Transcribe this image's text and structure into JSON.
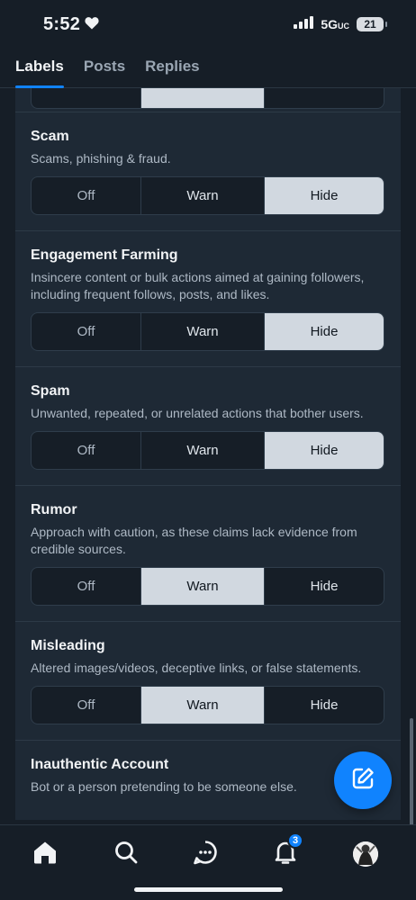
{
  "status_bar": {
    "time": "5:52",
    "network": "5G",
    "network_suffix": "UC",
    "battery": "21"
  },
  "tabs": [
    {
      "label": "Labels",
      "active": true
    },
    {
      "label": "Posts",
      "active": false
    },
    {
      "label": "Replies",
      "active": false
    }
  ],
  "segment_labels": {
    "off": "Off",
    "warn": "Warn",
    "hide": "Hide"
  },
  "sections": [
    {
      "title": "Scam",
      "description": "Scams, phishing & fraud.",
      "selected": "Hide"
    },
    {
      "title": "Engagement Farming",
      "description": "Insincere content or bulk actions aimed at gaining followers, including frequent follows, posts, and likes.",
      "selected": "Hide"
    },
    {
      "title": "Spam",
      "description": "Unwanted, repeated, or unrelated actions that bother users.",
      "selected": "Hide"
    },
    {
      "title": "Rumor",
      "description": "Approach with caution, as these claims lack evidence from credible sources.",
      "selected": "Warn"
    },
    {
      "title": "Misleading",
      "description": "Altered images/videos, deceptive links, or false statements.",
      "selected": "Warn"
    },
    {
      "title": "Inauthentic Account",
      "description": "Bot or a person pretending to be someone else."
    }
  ],
  "bottom_nav": {
    "notifications_badge": "3"
  },
  "colors": {
    "accent": "#1083fe",
    "background": "#161e27",
    "panel": "#1e2935",
    "selected_segment": "#d1d8e0"
  }
}
